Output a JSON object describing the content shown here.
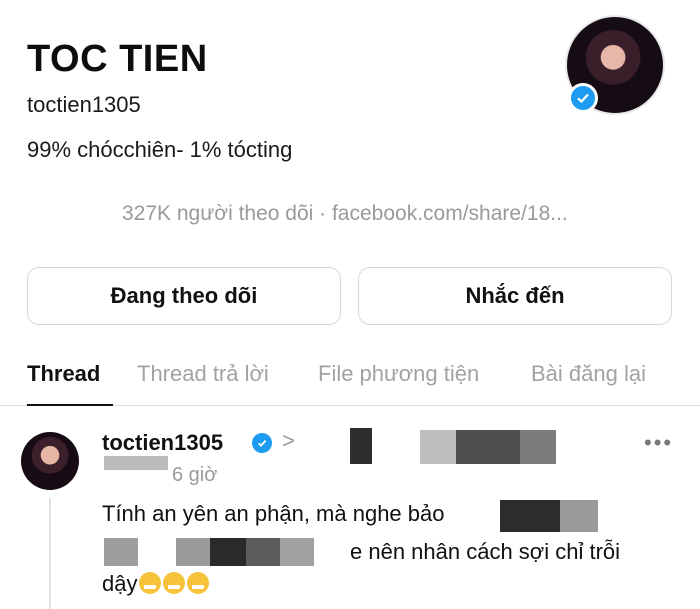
{
  "profile": {
    "name": "TOC TIEN",
    "handle": "toctien1305",
    "bio": "99% chócchiên- 1% tócting",
    "stats": "327K người theo dõi · facebook.com/share/18..."
  },
  "buttons": {
    "following": "Đang theo dõi",
    "mention": "Nhắc đến"
  },
  "tabs": [
    {
      "label": "Thread",
      "active": true
    },
    {
      "label": "Thread trả lời"
    },
    {
      "label": "File phương tiện"
    },
    {
      "label": "Bài đăng lại"
    }
  ],
  "post": {
    "username": "toctien1305",
    "arrow": ">",
    "time": "6 giờ",
    "line1": "Tính an yên an phận, mà nghe bảo",
    "line2": "e nên nhân cách sợi chỉ trỗi",
    "line3": "dậy",
    "more": "•••"
  },
  "icons": {
    "verified": "verified-badge-icon",
    "more": "more-horizontal-icon",
    "emoji": "face-with-steam-emoji"
  },
  "colors": {
    "verified": "#1d9bf0",
    "muted_text": "#9a9a9a"
  }
}
